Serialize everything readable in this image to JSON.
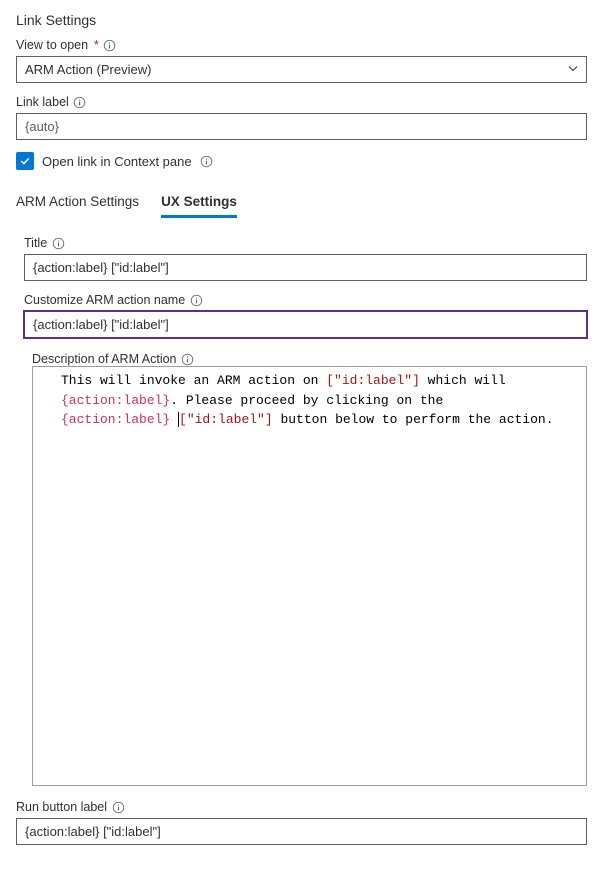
{
  "header": {
    "title": "Link Settings"
  },
  "viewToOpen": {
    "label": "View to open",
    "value": "ARM Action (Preview)"
  },
  "linkLabel": {
    "label": "Link label",
    "value": "{auto}"
  },
  "openContext": {
    "label": "Open link in Context pane",
    "checked": true
  },
  "tabs": {
    "arm": "ARM Action Settings",
    "ux": "UX Settings"
  },
  "title": {
    "label": "Title",
    "value": "{action:label} [\"id:label\"]"
  },
  "customizeName": {
    "label": "Customize ARM action name",
    "value": "{action:label} [\"id:label\"]"
  },
  "description": {
    "label": "Description of ARM Action",
    "t1": "This will invoke an ARM action on ",
    "t2": "[\"id:label\"]",
    "t3": " which will ",
    "t4": "{action:label}",
    "t5": ". Please proceed by clicking on the ",
    "t6": "{action:label}",
    "t7": "[\"id:label\"]",
    "t8": " button below to perform the action."
  },
  "runButton": {
    "label": "Run button label",
    "value": "{action:label} [\"id:label\"]"
  }
}
